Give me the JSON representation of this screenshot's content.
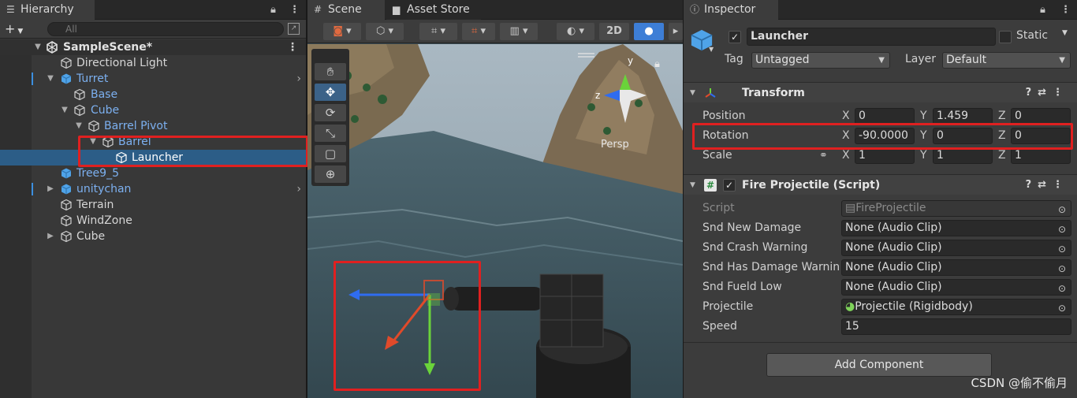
{
  "hierarchy": {
    "tab_label": "Hierarchy",
    "search_placeholder": "All",
    "items": [
      {
        "label": "SampleScene*",
        "type": "scene"
      },
      {
        "label": "Directional Light",
        "type": "object"
      },
      {
        "label": "Turret",
        "type": "prefab"
      },
      {
        "label": "Base",
        "type": "prefab"
      },
      {
        "label": "Cube",
        "type": "prefab"
      },
      {
        "label": "Barrel Pivot",
        "type": "prefab"
      },
      {
        "label": "Barrel",
        "type": "prefab"
      },
      {
        "label": "Launcher",
        "type": "object",
        "selected": true
      },
      {
        "label": "Tree9_5",
        "type": "prefab"
      },
      {
        "label": "unitychan",
        "type": "prefab"
      },
      {
        "label": "Terrain",
        "type": "object"
      },
      {
        "label": "WindZone",
        "type": "object"
      },
      {
        "label": "Cube",
        "type": "object"
      }
    ]
  },
  "scene": {
    "tabs": [
      {
        "label": "Scene"
      },
      {
        "label": "Asset Store"
      }
    ],
    "toolbar": {
      "mode_2d": "2D"
    },
    "persp_label": "Persp",
    "gizmo_axes": {
      "y": "y",
      "z": "z"
    }
  },
  "inspector": {
    "tab_label": "Inspector",
    "object_name": "Launcher",
    "static_label": "Static",
    "tag_label": "Tag",
    "tag_value": "Untagged",
    "layer_label": "Layer",
    "layer_value": "Default",
    "transform": {
      "title": "Transform",
      "position_label": "Position",
      "rotation_label": "Rotation",
      "scale_label": "Scale",
      "axis_x": "X",
      "axis_y": "Y",
      "axis_z": "Z",
      "position": {
        "x": "0",
        "y": "1.459",
        "z": "0"
      },
      "rotation": {
        "x": "-90.0000",
        "y": "0",
        "z": "0"
      },
      "scale": {
        "x": "1",
        "y": "1",
        "z": "1"
      }
    },
    "script_component": {
      "title": "Fire Projectile (Script)",
      "fields": [
        {
          "label": "Script",
          "value": "FireProjectile"
        },
        {
          "label": "Snd New Damage",
          "value": "None (Audio Clip)"
        },
        {
          "label": "Snd Crash Warning",
          "value": "None (Audio Clip)"
        },
        {
          "label": "Snd Has Damage Warnin",
          "value": "None (Audio Clip)"
        },
        {
          "label": "Snd Fueld Low",
          "value": "None (Audio Clip)"
        },
        {
          "label": "Projectile",
          "value": "Projectile (Rigidbody)"
        },
        {
          "label": "Speed",
          "value": "15"
        }
      ]
    },
    "add_component_label": "Add Component"
  },
  "watermark": "CSDN @偷不偷月",
  "colors": {
    "selection": "#2c5d87",
    "prefab_text": "#7cb0f0",
    "highlight_box": "#e02020",
    "active_tool": "#3b6288"
  }
}
